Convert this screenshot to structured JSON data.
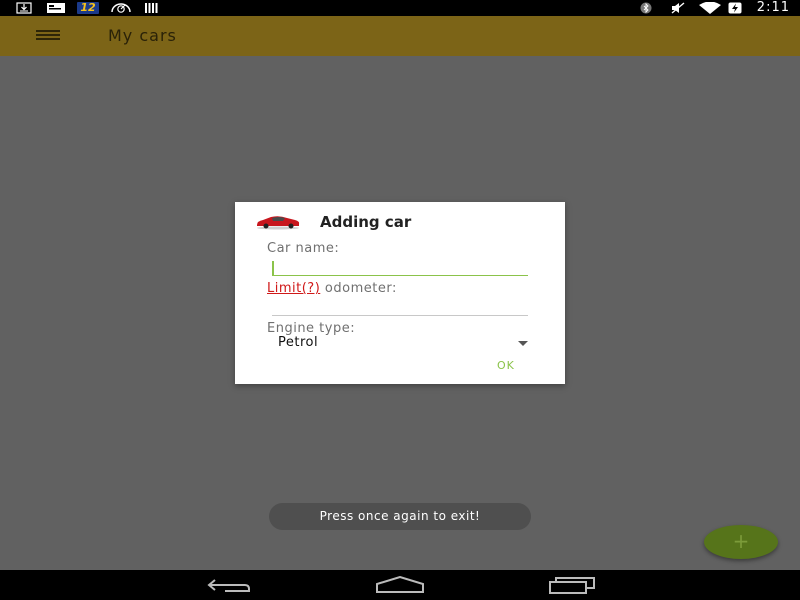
{
  "status_bar": {
    "time": "2:11",
    "notification_badge": "12",
    "left_icons": [
      "download-icon",
      "card-icon",
      "badge-12-icon",
      "speedometer-icon",
      "barcode-icon"
    ],
    "right_icons": [
      "bluetooth-icon",
      "mute-icon",
      "wifi-icon",
      "battery-charging-icon"
    ]
  },
  "app_bar": {
    "title": "My cars",
    "menu_icon": "hamburger-menu-icon",
    "color": "#7c6417"
  },
  "dialog": {
    "title": "Adding car",
    "icon": "red-car-icon",
    "car_name_label": "Car name:",
    "car_name_value": "",
    "limit_link": "Limit(?)",
    "odometer_label": " odometer:",
    "odometer_value": "",
    "engine_type_label": "Engine type:",
    "engine_type_value": "Petrol",
    "ok_label": "OK",
    "accent_color": "#8bc34a",
    "link_color": "#d01919"
  },
  "toast": {
    "message": "Press once again to exit!"
  },
  "fab": {
    "icon": "plus-icon",
    "label": "+"
  },
  "nav_bar": {
    "buttons": [
      "back-icon",
      "home-icon",
      "recent-apps-icon"
    ]
  }
}
